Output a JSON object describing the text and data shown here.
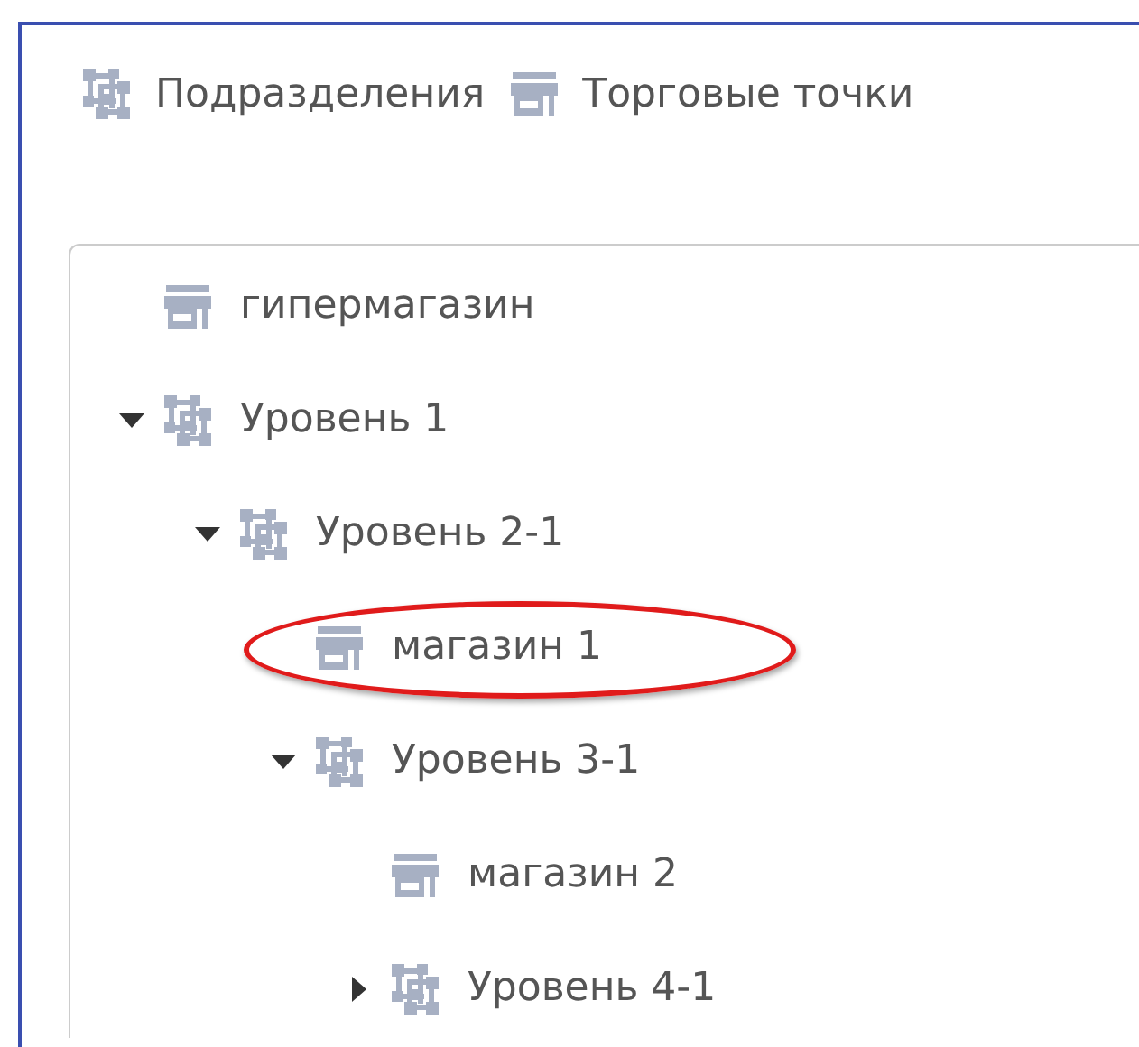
{
  "legend": [
    {
      "kind": "unit",
      "label": "Подразделения"
    },
    {
      "kind": "store",
      "label": "Торговые точки"
    }
  ],
  "tree": [
    {
      "kind": "store",
      "label": "гипермагазин",
      "circled": false
    },
    {
      "kind": "unit",
      "label": "Уровень 1",
      "expanded": true,
      "circled": false,
      "children": [
        {
          "kind": "unit",
          "label": "Уровень 2-1",
          "expanded": true,
          "circled": false,
          "children": [
            {
              "kind": "store",
              "label": "магазин 1",
              "circled": true
            },
            {
              "kind": "unit",
              "label": "Уровень 3-1",
              "expanded": true,
              "circled": false,
              "children": [
                {
                  "kind": "store",
                  "label": "магазин 2",
                  "circled": false
                },
                {
                  "kind": "unit",
                  "label": "Уровень 4-1",
                  "expanded": false,
                  "circled": false
                }
              ]
            }
          ]
        }
      ]
    }
  ]
}
